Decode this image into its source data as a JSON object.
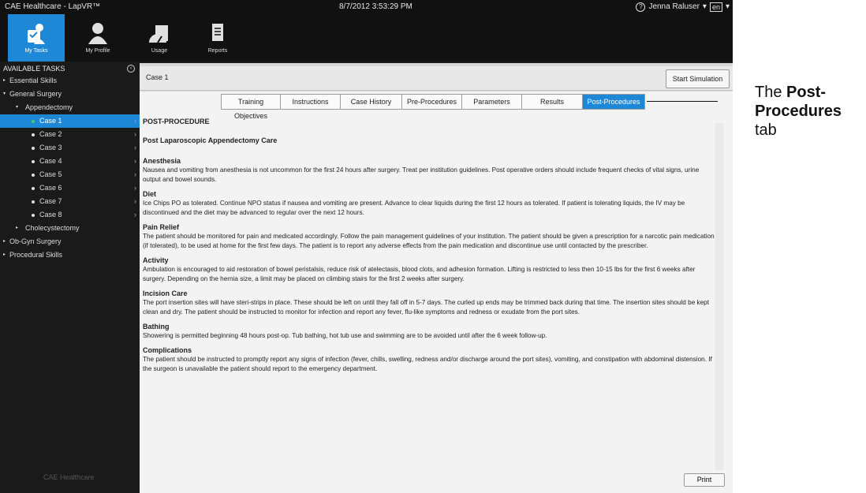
{
  "titlebar": {
    "app_title": "CAE Healthcare - LapVR™",
    "datetime": "8/7/2012 3:53:29 PM",
    "user": "Jenna Raluser",
    "language": "en"
  },
  "toolbar": {
    "items": [
      {
        "label": "My Tasks",
        "icon": "my-tasks-icon"
      },
      {
        "label": "My Profile",
        "icon": "profile-icon"
      },
      {
        "label": "Usage",
        "icon": "usage-icon"
      },
      {
        "label": "Reports",
        "icon": "reports-icon"
      }
    ]
  },
  "sidebar": {
    "header": "AVAILABLE TASKS",
    "items": [
      {
        "label": "Essential Skills"
      },
      {
        "label": "General Surgery"
      },
      {
        "label": "Appendectomy"
      },
      {
        "label": "Case 1"
      },
      {
        "label": "Case 2"
      },
      {
        "label": "Case 3"
      },
      {
        "label": "Case 4"
      },
      {
        "label": "Case 5"
      },
      {
        "label": "Case 6"
      },
      {
        "label": "Case 7"
      },
      {
        "label": "Case 8"
      },
      {
        "label": "Cholecystectomy"
      },
      {
        "label": "Ob-Gyn Surgery"
      },
      {
        "label": "Procedural Skills"
      }
    ],
    "logo_text": "CAE Healthcare"
  },
  "case": {
    "title": "Case 1",
    "start_label": "Start Simulation"
  },
  "tabs": [
    {
      "label": "Training Objectives"
    },
    {
      "label": "Instructions"
    },
    {
      "label": "Case History"
    },
    {
      "label": "Pre-Procedures"
    },
    {
      "label": "Parameters"
    },
    {
      "label": "Results"
    },
    {
      "label": "Post-Procedures"
    }
  ],
  "doc": {
    "heading": "POST-PROCEDURE",
    "subheading": "Post Laparoscopic Appendectomy Care",
    "sections": [
      {
        "title": "Anesthesia",
        "body": "Nausea and vomiting from anesthesia is not uncommon for the first 24 hours after surgery. Treat per institution guidelines. Post operative orders should include frequent checks of vital signs, urine output and bowel sounds."
      },
      {
        "title": "Diet",
        "body": "Ice Chips PO as tolerated. Continue NPO status if nausea and vomiting are present. Advance to clear liquids during the first 12 hours as tolerated. If patient is tolerating liquids, the IV may be discontinued and the diet may be advanced to regular over the next 12 hours."
      },
      {
        "title": "Pain Relief",
        "body": "The patient should be monitored for pain and medicated accordingly. Follow the pain management guidelines of your institution. The patient should be given a prescription for a narcotic pain medication (if tolerated), to be used at home for the first few days. The patient is to report any adverse effects from the pain medication and discontinue use until contacted by the prescriber."
      },
      {
        "title": "Activity",
        "body": "Ambulation is encouraged to aid restoration of bowel peristalsis, reduce risk of atelectasis, blood clots, and adhesion formation. Lifting is restricted to less then 10-15 lbs for the first 6 weeks after surgery. Depending on the hernia size, a limit may be placed on climbing stairs for the first 2 weeks after surgery."
      },
      {
        "title": "Incision Care",
        "body": "The port insertion sites will have steri-strips in place. These should be left on until they fall off in 5-7 days. The curled up ends may be trimmed back during that time. The insertion sites should be kept clean and dry. The patient should be instructed to monitor for infection and report any fever, flu-like symptoms and redness or exudate from the port sites."
      },
      {
        "title": "Bathing",
        "body": "Showering is permitted beginning 48 hours post-op. Tub bathing, hot tub use and swimming are to be avoided until after the 6 week follow-up."
      },
      {
        "title": "Complications",
        "body": "The patient should be instructed to promptly report any signs of infection (fever, chills, swelling, redness and/or discharge around the port sites), vomiting, and constipation with abdominal distension. If the surgeon is unavailable the patient should report to the emergency department."
      }
    ],
    "print_label": "Print"
  },
  "callout": {
    "prefix": "The",
    "bold": "Post-Procedures",
    "suffix": "tab"
  }
}
